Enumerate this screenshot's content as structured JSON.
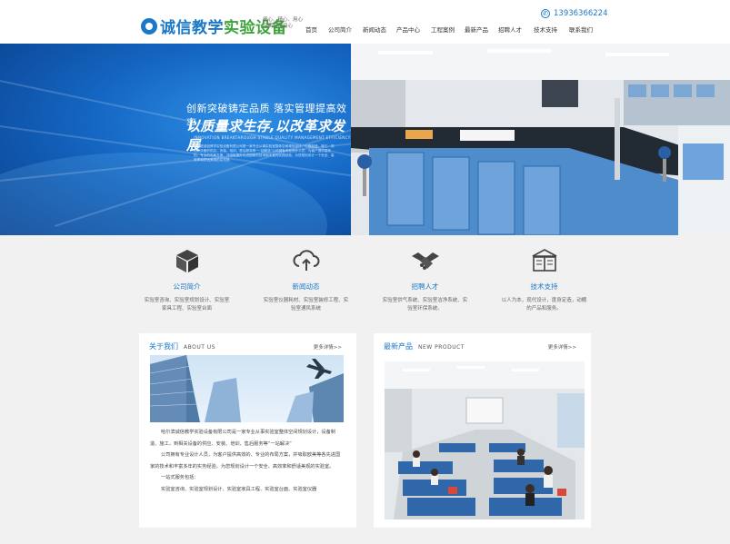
{
  "header": {
    "logo_text_a": "诚信教学",
    "logo_text_b": "实验设备",
    "tagline": "细心、精心、用心 品质永保初心",
    "phone": "13936366224",
    "nav": [
      "首页",
      "公司简介",
      "新闻动态",
      "产品中心",
      "工程案例",
      "最新产品",
      "招聘人才",
      "技术支持",
      "联系我们"
    ]
  },
  "banner": {
    "slogan1": "创新突破铸定品质   落实管理提高效率",
    "slogan2": "以质量求生存,以改革求发展",
    "slogan_en": "INNOVATION BREAKTHROUGH STABLE QUALITY MANAGEMENT EFFICIENCY",
    "description": "哈尔滨诚信教学实验设备有限公司是一家专业从事实验室整体空间规划设计、仪器制造、施工，到相关设备的供应、安装、培训、售后服务等“一站解决”公司拥有专业设计人员，为客户提供高效的、专业的布局方案，并吸取国外先进国家的技术和丰富的实践经验，为您规划设计一个安全、高效率和舒适美观的实验室。"
  },
  "services": [
    {
      "icon": "cube-icon",
      "title": "公司简介",
      "desc": "实验室咨询、实验室规划设计、实验室家具工程、实验室台面"
    },
    {
      "icon": "cloud-upload-icon",
      "title": "新闻动态",
      "desc": "实验室仪器耗材、实验室装修工程、实验室通风系统"
    },
    {
      "icon": "handshake-icon",
      "title": "招聘人才",
      "desc": "实验室供气系统、实验室洁净系统、实验室环保系统。"
    },
    {
      "icon": "book-icon",
      "title": "技术支持",
      "desc": "以人为本，现代设计，度身定造，动棚的产品和服务。"
    }
  ],
  "about": {
    "title": "关于我们",
    "title_en": "ABOUT US",
    "more": "更多详情>>",
    "paragraphs": [
      "哈尔滨诚信教学实验设备有限公司是一家专业从事实验室整体空间规划设计，设备制造、施工，到相关设备的供应、安装、培训、售后服务等“一站解决”",
      "公司拥有专业设计人员，为客户提供高效的、专业的布局方案，并吸取欧美等各先进国家的技术和丰富多年的实务经验，为您规划设计一个安全、高效率和舒适美观的实验室。",
      "一站式服务包括：",
      "实验室咨询、实验室规划设计、实验室家具工程、实验室台面、实验室仪器"
    ]
  },
  "product": {
    "title": "最新产品",
    "title_en": "NEW PRODUCT",
    "more": "更多详情>>"
  },
  "colors": {
    "accent": "#1b78c9",
    "green": "#3fa33c",
    "banner_blue": "#1466c2",
    "background": "#f1f1f1"
  }
}
